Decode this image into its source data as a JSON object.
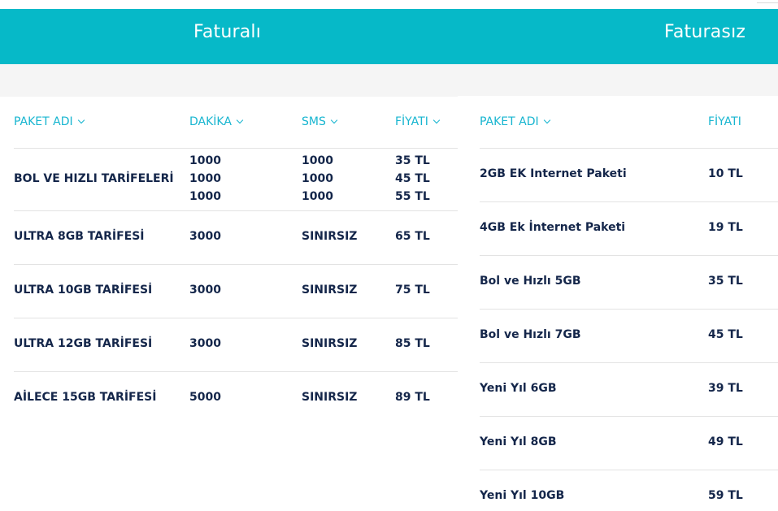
{
  "tabs": {
    "left": "Faturalı",
    "right": "Faturasız"
  },
  "faturali": {
    "headers": {
      "name": "PAKET ADI",
      "minutes": "DAKİKA",
      "sms": "SMS",
      "price": "FİYATI"
    },
    "rows": [
      {
        "name": "BOL VE HIZLI TARİFELERİ",
        "minutes": [
          "1000",
          "1000",
          "1000"
        ],
        "sms": [
          "1000",
          "1000",
          "1000"
        ],
        "price": [
          "35 TL",
          "45 TL",
          "55 TL"
        ]
      },
      {
        "name": "ULTRA 8GB TARİFESİ",
        "minutes": "3000",
        "sms": "SINIRSIZ",
        "price": "65 TL"
      },
      {
        "name": "ULTRA 10GB TARİFESİ",
        "minutes": "3000",
        "sms": "SINIRSIZ",
        "price": "75 TL"
      },
      {
        "name": "ULTRA 12GB TARİFESİ",
        "minutes": "3000",
        "sms": "SINIRSIZ",
        "price": "85 TL"
      },
      {
        "name": "AİLECE 15GB TARİFESİ",
        "minutes": "5000",
        "sms": "SINIRSIZ",
        "price": "89 TL"
      }
    ]
  },
  "faturasiz": {
    "headers": {
      "name": "PAKET ADI",
      "price": "FİYATI"
    },
    "rows": [
      {
        "name": "2GB EK Internet Paketi",
        "price": "10 TL"
      },
      {
        "name": "4GB Ek İnternet Paketi",
        "price": "19 TL"
      },
      {
        "name": "Bol ve Hızlı 5GB",
        "price": "35 TL"
      },
      {
        "name": "Bol ve Hızlı 7GB",
        "price": "45 TL"
      },
      {
        "name": "Yeni Yıl 6GB",
        "price": "39 TL"
      },
      {
        "name": "Yeni Yıl 8GB",
        "price": "49 TL"
      },
      {
        "name": "Yeni Yıl 10GB",
        "price": "59 TL"
      }
    ]
  },
  "colors": {
    "accent": "#06b9c8",
    "header_text": "#17b5d0",
    "body_text": "#14264a"
  }
}
